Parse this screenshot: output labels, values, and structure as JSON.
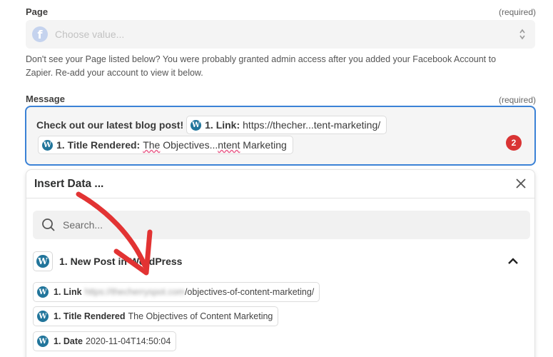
{
  "page_field": {
    "label": "Page",
    "required": "(required)",
    "placeholder": "Choose value...",
    "help": "Don't see your Page listed below? You were probably granted admin access after you added your Facebook Account to Zapier. Re-add your account to view it below."
  },
  "message_field": {
    "label": "Message",
    "required": "(required)",
    "text": "Check out our latest blog post!",
    "pill_link": {
      "key": "1. Link:",
      "value": "https://thecher...tent-marketing/"
    },
    "pill_title": {
      "key": "1. Title Rendered:",
      "value_a": "The",
      "value_b": " Objectives...",
      "value_c": "ntent",
      "value_d": " Marketing"
    },
    "badge": "2"
  },
  "insert_data": {
    "title": "Insert Data ...",
    "search_placeholder": "Search...",
    "group_title": "1. New Post in WordPress",
    "items": [
      {
        "key": "1. Link",
        "hidden": "https://thecherryspot.com",
        "value": "/objectives-of-content-marketing/"
      },
      {
        "key": "1. Title Rendered",
        "value": "The Objectives of Content Marketing"
      },
      {
        "key": "1. Date",
        "value": "2020-11-04T14:50:04"
      }
    ]
  },
  "colors": {
    "accent": "#3b82d6",
    "badge": "#d93434",
    "wordpress": "#21759b",
    "annotation_arrow": "#e23333"
  },
  "icons": [
    "facebook-icon",
    "updown-icon",
    "wordpress-icon",
    "close-icon",
    "search-icon",
    "chevron-up-icon"
  ]
}
